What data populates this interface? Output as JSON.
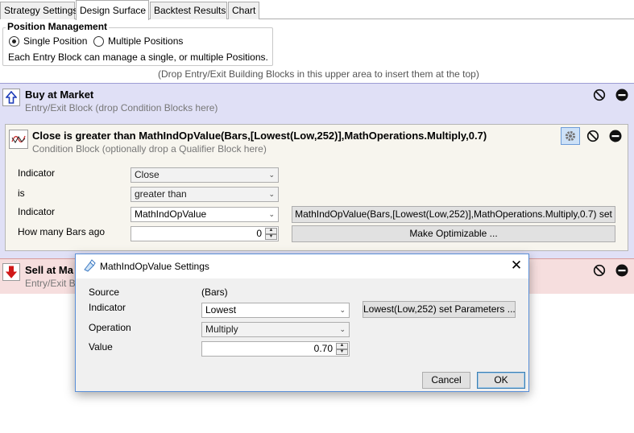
{
  "tabs": [
    {
      "label": "Strategy Settings"
    },
    {
      "label": "Design Surface"
    },
    {
      "label": "Backtest Results"
    },
    {
      "label": "Chart"
    }
  ],
  "position_management": {
    "title": "Position Management",
    "option_single": "Single Position",
    "option_multiple": "Multiple Positions",
    "selected": "Single Position",
    "description": "Each Entry Block can manage a single, or multiple Positions."
  },
  "drop_hint": "(Drop Entry/Exit Building Blocks in this upper area to insert them at the top)",
  "buy_block": {
    "title": "Buy at Market",
    "subtitle": "Entry/Exit Block (drop Condition Blocks here)",
    "icon": "up-arrow-icon",
    "color": "#e0e0f6"
  },
  "condition_block": {
    "title": "Close is greater than MathIndOpValue(Bars,[Lowest(Low,252)],MathOperations.Multiply,0.7)",
    "subtitle": "Condition Block (optionally drop a Qualifier Block here)",
    "icon": "indicator-curve-icon",
    "fields": {
      "indicator1_label": "Indicator",
      "indicator1_value": "Close",
      "is_label": "is",
      "is_value": "greater than",
      "indicator2_label": "Indicator",
      "indicator2_value": "MathIndOpValue",
      "indicator2_params_button": "MathIndOpValue(Bars,[Lowest(Low,252)],MathOperations.Multiply,0.7) set",
      "bars_ago_label": "How many Bars ago",
      "bars_ago_value": "0",
      "optimizable_button": "Make Optimizable ..."
    }
  },
  "sell_block": {
    "title": "Sell at Ma",
    "subtitle": "Entry/Exit Bl",
    "icon": "down-arrow-icon",
    "color": "#f6dede"
  },
  "dialog": {
    "title": "MathIndOpValue Settings",
    "source_label": "Source",
    "source_value": "(Bars)",
    "indicator_label": "Indicator",
    "indicator_value": "Lowest",
    "indicator_params_button": "Lowest(Low,252) set Parameters ...",
    "operation_label": "Operation",
    "operation_value": "Multiply",
    "value_label": "Value",
    "value_value": "0.70",
    "cancel_label": "Cancel",
    "ok_label": "OK"
  }
}
